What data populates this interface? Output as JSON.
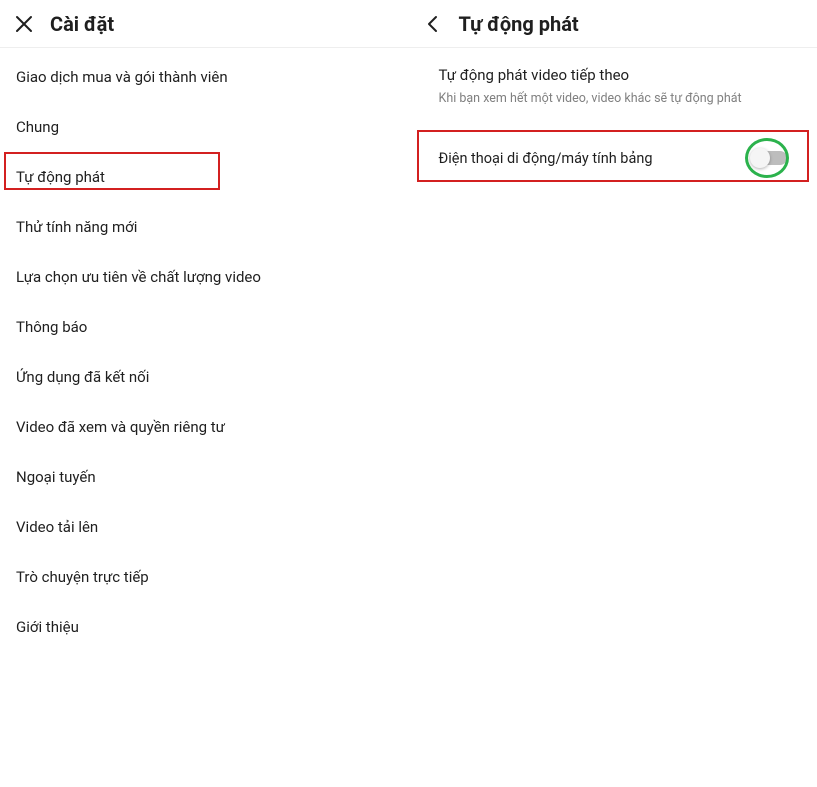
{
  "left": {
    "title": "Cài đặt",
    "items": [
      "Giao dịch mua và gói thành viên",
      "Chung",
      "Tự động phát",
      "Thử tính năng mới",
      "Lựa chọn ưu tiên về chất lượng video",
      "Thông báo",
      "Ứng dụng đã kết nối",
      "Video đã xem và quyền riêng tư",
      "Ngoại tuyến",
      "Video tải lên",
      "Trò chuyện trực tiếp",
      "Giới thiệu"
    ]
  },
  "right": {
    "title": "Tự động phát",
    "section_title": "Tự động phát video tiếp theo",
    "section_sub": "Khi bạn xem hết một video, video khác sẽ tự động phát",
    "row_label": "Điện thoại di động/máy tính bảng",
    "toggle_on": false
  }
}
